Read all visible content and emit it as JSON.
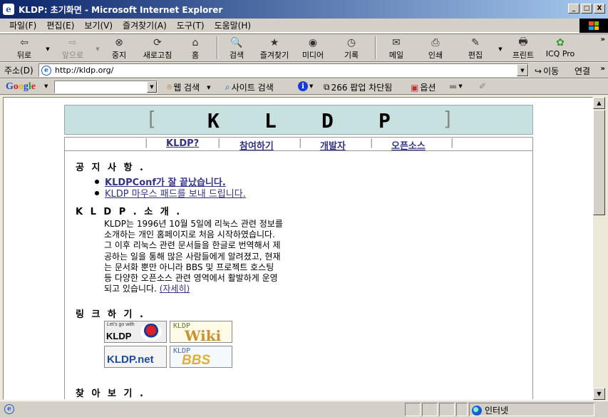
{
  "window": {
    "title": "KLDP: 초기화면 - Microsoft Internet Explorer",
    "min": "_",
    "max": "□",
    "close": "X"
  },
  "menu": [
    "파일(F)",
    "편집(E)",
    "보기(V)",
    "즐겨찾기(A)",
    "도구(T)",
    "도움말(H)"
  ],
  "toolbar": {
    "back": "뒤로",
    "forward": "앞으로",
    "stop": "중지",
    "refresh": "새로고침",
    "home": "홈",
    "search": "검색",
    "favorites": "즐겨찾기",
    "media": "미디어",
    "history": "기록",
    "mail": "메일",
    "print": "인쇄",
    "edit": "편집",
    "printer": "프린트",
    "icq": "ICQ Pro"
  },
  "address": {
    "label": "주소(D)",
    "url": "http://kldp.org/",
    "go": "이동",
    "links": "연결",
    "more": "»"
  },
  "googlebar": {
    "logo": "Google",
    "web_search": "웹 검색",
    "site_search": "사이트 검색",
    "popup": "266 팝업 차단됨",
    "options": "옵션"
  },
  "page": {
    "banner": {
      "open": "[",
      "close": "]",
      "letters": [
        "K",
        "L",
        "D",
        "P"
      ]
    },
    "nav": [
      "KLDP?",
      "참여하기",
      "개발자",
      "오픈소스"
    ],
    "notice": {
      "heading": "공 지 사 항 .",
      "items": [
        "KLDPConf가 잘 끝났습니다.",
        "KLDP 마우스 패드를 보내 드립니다."
      ]
    },
    "intro": {
      "heading": "K L D P . 소 개 .",
      "lines": [
        "KLDP는 1996년 10월 5일에 리눅스 관련 정보를",
        "소개하는 개인 홈페이지로 처음 시작하였습니다.",
        "그 이후 리눅스 관련 문서들을 한글로 번역해서 제",
        "공하는 일을 통해 많은 사람들에게 알려졌고, 현재",
        "는 문서화 뿐만 아니라 BBS 및 프로젝트 호스팅",
        "등 다양한 오픈소스 관련 영역에서 활발하게 운영",
        "되고 있습니다."
      ],
      "more": "(자세히)"
    },
    "links": {
      "heading": "링 크 하 기 .",
      "letsgo_small": "Let's go with",
      "letsgo_big": "KLDP",
      "wiki_k": "KLDP",
      "wiki_w": "Wiki",
      "net": "KLDP.net",
      "bbs_k": "KLDP",
      "bbs_w": "BBS"
    },
    "find": {
      "heading": "찾 아 보 기 ."
    }
  },
  "status": {
    "zone": "인터넷"
  }
}
